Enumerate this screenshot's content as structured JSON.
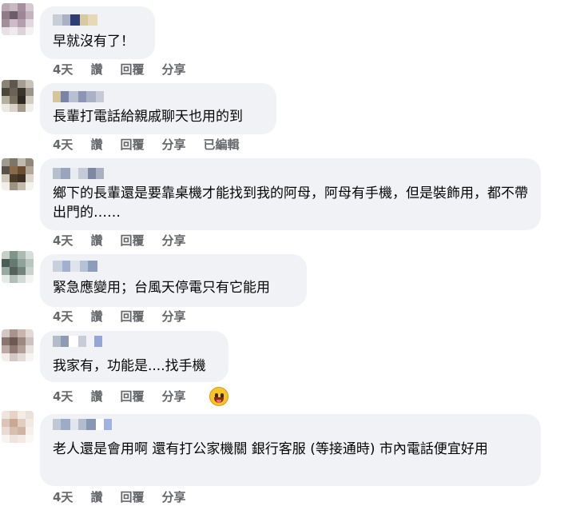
{
  "comments": [
    {
      "text": "早就沒有了！",
      "actions": {
        "time": "4天",
        "like": "讚",
        "reply": "回覆",
        "share": "分享"
      }
    },
    {
      "text": "長輩打電話給親戚聊天也用的到",
      "actions": {
        "time": "4天",
        "like": "讚",
        "reply": "回覆",
        "share": "分享",
        "edited": "已編輯"
      }
    },
    {
      "text": "鄉下的長輩還是要靠桌機才能找到我的阿母，阿母有手機，但是裝飾用，都不帶出門的……",
      "actions": {
        "time": "4天",
        "like": "讚",
        "reply": "回覆",
        "share": "分享"
      }
    },
    {
      "text": "緊急應變用；台風天停電只有它能用",
      "actions": {
        "time": "4天",
        "like": "讚",
        "reply": "回覆",
        "share": "分享"
      }
    },
    {
      "text": "我家有，功能是....找手機",
      "actions": {
        "time": "4天",
        "like": "讚",
        "reply": "回覆",
        "share": "分享"
      },
      "reaction_icon": "grinning-face-icon"
    },
    {
      "text": "老人還是會用啊 還有打公家機關 銀行客服 (等接通時) 市內電話便宜好用",
      "actions": {
        "time": "4天",
        "like": "讚",
        "reply": "回覆",
        "share": "分享"
      }
    }
  ],
  "colors": {
    "bubble_bg": "#f0f2f5",
    "action_text": "#65676b",
    "comment_text": "#050505"
  }
}
